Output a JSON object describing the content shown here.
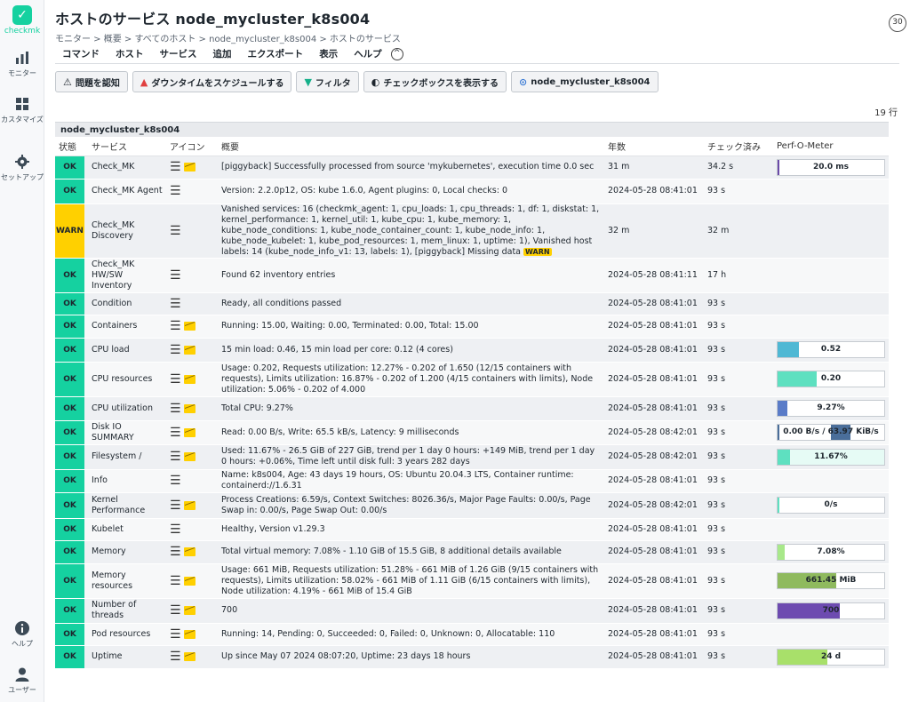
{
  "sidebar": {
    "logo_text": "checkmk",
    "items": [
      {
        "label": "モニター",
        "icon": "bar-chart-icon"
      },
      {
        "label": "カスタマイズ",
        "icon": "grid-icon"
      },
      {
        "label": "セットアップ",
        "icon": "gear-icon"
      },
      {
        "label": "ヘルプ",
        "icon": "info-icon"
      },
      {
        "label": "ユーザー",
        "icon": "user-icon"
      }
    ]
  },
  "header": {
    "title": "ホストのサービス node_mycluster_k8s004",
    "breadcrumb": "モニター > 概要 > すべてのホスト > node_mycluster_k8s004 > ホストのサービス",
    "refresh": "30"
  },
  "menubar": [
    "コマンド",
    "ホスト",
    "サービス",
    "追加",
    "エクスポート",
    "表示",
    "ヘルプ"
  ],
  "toolbar": [
    {
      "label": "問題を認知",
      "icon": "warning-icon",
      "glyph": "⚠"
    },
    {
      "label": "ダウンタイムをスケジュールする",
      "icon": "cone-icon",
      "glyph": "▲"
    },
    {
      "label": "フィルタ",
      "icon": "filter-icon",
      "glyph": "▼"
    },
    {
      "label": "チェックボックスを表示する",
      "icon": "toggle-icon",
      "glyph": "◐"
    },
    {
      "label": "node_mycluster_k8s004",
      "icon": "host-icon",
      "glyph": "⊙"
    }
  ],
  "row_count": "19 行",
  "table": {
    "host": "node_mycluster_k8s004",
    "columns": [
      "状態",
      "サービス",
      "アイコン",
      "概要",
      "年数",
      "チェック済み",
      "Perf-O-Meter"
    ],
    "rows": [
      {
        "state": "OK",
        "service": "Check_MK",
        "graph": true,
        "summary": "[piggyback] Successfully processed from source 'mykubernetes', execution time 0.0 sec",
        "age": "31 m",
        "checked": "34.2 s",
        "perf": {
          "text": "20.0 ms",
          "pct": 0.01,
          "color": "#6b4aa8"
        }
      },
      {
        "state": "OK",
        "service": "Check_MK Agent",
        "graph": false,
        "summary": "Version: 2.2.0p12, OS: kube 1.6.0, Agent plugins: 0, Local checks: 0",
        "age": "2024-05-28 08:41:01",
        "checked": "93 s",
        "perf": null
      },
      {
        "state": "WARN",
        "service": "Check_MK Discovery",
        "graph": false,
        "summary": "Vanished services: 16 (checkmk_agent: 1, cpu_loads: 1, cpu_threads: 1, df: 1, diskstat: 1, kernel_performance: 1, kernel_util: 1, kube_cpu: 1, kube_memory: 1, kube_node_conditions: 1, kube_node_container_count: 1, kube_node_info: 1, kube_node_kubelet: 1, kube_pod_resources: 1, mem_linux: 1, uptime: 1), Vanished host labels: 14 (kube_node_info_v1: 13, labels: 1), [piggyback] Missing data",
        "warn_tag": "WARN",
        "age": "32 m",
        "checked": "32 m",
        "perf": null
      },
      {
        "state": "OK",
        "service": "Check_MK HW/SW Inventory",
        "graph": false,
        "summary": "Found 62 inventory entries",
        "age": "2024-05-28 08:41:11",
        "checked": "17 h",
        "perf": null
      },
      {
        "state": "OK",
        "service": "Condition",
        "graph": false,
        "summary": "Ready, all conditions passed",
        "age": "2024-05-28 08:41:01",
        "checked": "93 s",
        "perf": null
      },
      {
        "state": "OK",
        "service": "Containers",
        "graph": true,
        "summary": "Running: 15.00, Waiting: 0.00, Terminated: 0.00, Total: 15.00",
        "age": "2024-05-28 08:41:01",
        "checked": "93 s",
        "perf": null
      },
      {
        "state": "OK",
        "service": "CPU load",
        "graph": true,
        "summary": "15 min load: 0.46, 15 min load per core: 0.12 (4 cores)",
        "age": "2024-05-28 08:41:01",
        "checked": "93 s",
        "perf": {
          "text": "0.52",
          "pct": 0.2,
          "color": "#4fb8d4"
        }
      },
      {
        "state": "OK",
        "service": "CPU resources",
        "graph": true,
        "summary": "Usage: 0.202, Requests utilization: 12.27% - 0.202 of 1.650 (12/15 containers with requests), Limits utilization: 16.87% - 0.202 of 1.200 (4/15 containers with limits), Node utilization: 5.06% - 0.202 of 4.000",
        "age": "2024-05-28 08:41:01",
        "checked": "93 s",
        "perf": {
          "text": "0.20",
          "pct": 0.37,
          "color": "#5ee0c0"
        }
      },
      {
        "state": "OK",
        "service": "CPU utilization",
        "graph": true,
        "summary": "Total CPU: 9.27%",
        "age": "2024-05-28 08:41:01",
        "checked": "93 s",
        "perf": {
          "text": "9.27%",
          "pct": 0.09,
          "color": "#5a7cc8"
        }
      },
      {
        "state": "OK",
        "service": "Disk IO SUMMARY",
        "graph": true,
        "summary": "Read: 0.00 B/s, Write: 65.5 kB/s, Latency: 9 milliseconds",
        "age": "2024-05-28 08:42:01",
        "checked": "93 s",
        "perf": {
          "text": "0.00 B/s / 63.97 KiB/s",
          "pct": 0.0,
          "color": "#4a6e9a",
          "right_pct": 0.18
        }
      },
      {
        "state": "OK",
        "service": "Filesystem /",
        "graph": true,
        "summary": "Used: 11.67% - 26.5 GiB of 227 GiB, trend per 1 day 0 hours: +149 MiB, trend per 1 day 0 hours: +0.06%, Time left until disk full: 3 years 282 days",
        "age": "2024-05-28 08:42:01",
        "checked": "93 s",
        "perf": {
          "text": "11.67%",
          "pct": 0.12,
          "color": "#5ee0c0",
          "bg": "#e6fbf5"
        }
      },
      {
        "state": "OK",
        "service": "Info",
        "graph": false,
        "summary": "Name: k8s004, Age: 43 days 19 hours, OS: Ubuntu 20.04.3 LTS, Container runtime: containerd://1.6.31",
        "age": "2024-05-28 08:41:01",
        "checked": "93 s",
        "perf": null
      },
      {
        "state": "OK",
        "service": "Kernel Performance",
        "graph": true,
        "summary": "Process Creations: 6.59/s, Context Switches: 8026.36/s, Major Page Faults: 0.00/s, Page Swap in: 0.00/s, Page Swap Out: 0.00/s",
        "age": "2024-05-28 08:42:01",
        "checked": "93 s",
        "perf": {
          "text": "0/s",
          "pct": 0.0,
          "color": "#5ee0c0"
        }
      },
      {
        "state": "OK",
        "service": "Kubelet",
        "graph": false,
        "summary": "Healthy, Version v1.29.3",
        "age": "2024-05-28 08:41:01",
        "checked": "93 s",
        "perf": null
      },
      {
        "state": "OK",
        "service": "Memory",
        "graph": true,
        "summary": "Total virtual memory: 7.08% - 1.10 GiB of 15.5 GiB, 8 additional details available",
        "age": "2024-05-28 08:41:01",
        "checked": "93 s",
        "perf": {
          "text": "7.08%",
          "pct": 0.07,
          "color": "#a8e88a"
        }
      },
      {
        "state": "OK",
        "service": "Memory resources",
        "graph": true,
        "summary": "Usage: 661 MiB, Requests utilization: 51.28% - 661 MiB of 1.26 GiB (9/15 containers with requests), Limits utilization: 58.02% - 661 MiB of 1.11 GiB (6/15 containers with limits), Node utilization: 4.19% - 661 MiB of 15.4 GiB",
        "age": "2024-05-28 08:41:01",
        "checked": "93 s",
        "perf": {
          "text": "661.45 MiB",
          "pct": 0.55,
          "color": "#8fba5e"
        }
      },
      {
        "state": "OK",
        "service": "Number of threads",
        "graph": true,
        "summary": "700",
        "age": "2024-05-28 08:41:01",
        "checked": "93 s",
        "perf": {
          "text": "700",
          "pct": 0.58,
          "color": "#6d4bb0"
        }
      },
      {
        "state": "OK",
        "service": "Pod resources",
        "graph": true,
        "summary": "Running: 14, Pending: 0, Succeeded: 0, Failed: 0, Unknown: 0, Allocatable: 110",
        "age": "2024-05-28 08:41:01",
        "checked": "93 s",
        "perf": null
      },
      {
        "state": "OK",
        "service": "Uptime",
        "graph": true,
        "summary": "Up since May 07 2024 08:07:20, Uptime: 23 days 18 hours",
        "age": "2024-05-28 08:41:01",
        "checked": "93 s",
        "perf": {
          "text": "24 d",
          "pct": 0.47,
          "color": "#a8e06a"
        }
      }
    ]
  }
}
